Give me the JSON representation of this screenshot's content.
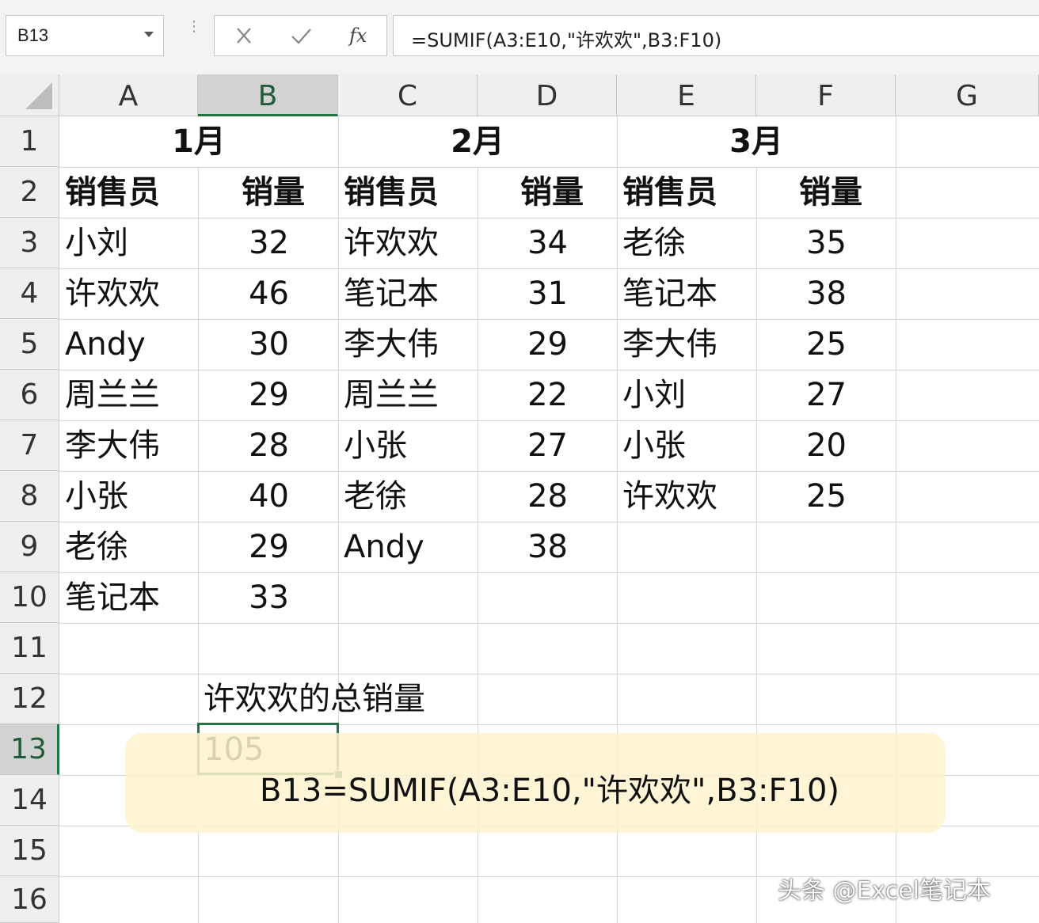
{
  "name_box": {
    "value": "B13"
  },
  "formula_bar": {
    "cancel_icon": "close-icon",
    "enter_icon": "check-icon",
    "fx_label": "fx",
    "formula": "=SUMIF(A3:E10,\"许欢欢\",B3:F10)"
  },
  "columns": [
    "A",
    "B",
    "C",
    "D",
    "E",
    "F",
    "G"
  ],
  "selected_column": "B",
  "rows": [
    "1",
    "2",
    "3",
    "4",
    "5",
    "6",
    "7",
    "8",
    "9",
    "10",
    "11",
    "12",
    "13",
    "14",
    "15",
    "16"
  ],
  "selected_row": "13",
  "sheet": {
    "months": [
      "1月",
      "2月",
      "3月"
    ],
    "headers": [
      "销售员",
      "销量",
      "销售员",
      "销量",
      "销售员",
      "销量"
    ],
    "data": [
      [
        "小刘",
        "32",
        "许欢欢",
        "34",
        "老徐",
        "35"
      ],
      [
        "许欢欢",
        "46",
        "笔记本",
        "31",
        "笔记本",
        "38"
      ],
      [
        "Andy",
        "30",
        "李大伟",
        "29",
        "李大伟",
        "25"
      ],
      [
        "周兰兰",
        "29",
        "周兰兰",
        "22",
        "小刘",
        "27"
      ],
      [
        "李大伟",
        "28",
        "小张",
        "27",
        "小张",
        "20"
      ],
      [
        "小张",
        "40",
        "老徐",
        "28",
        "许欢欢",
        "25"
      ],
      [
        "老徐",
        "29",
        "Andy",
        "38",
        "",
        ""
      ],
      [
        "笔记本",
        "33",
        "",
        "",
        "",
        ""
      ]
    ],
    "b12_label": "许欢欢的总销量",
    "b13_value": "105"
  },
  "note": {
    "text": "B13=SUMIF(A3:E10,\"许欢欢\",B3:F10)"
  },
  "watermark": "头条 @Excel笔记本",
  "colors": {
    "selection": "#217346",
    "header_bg": "#efefef",
    "note_bg": "#fdf3ce"
  }
}
